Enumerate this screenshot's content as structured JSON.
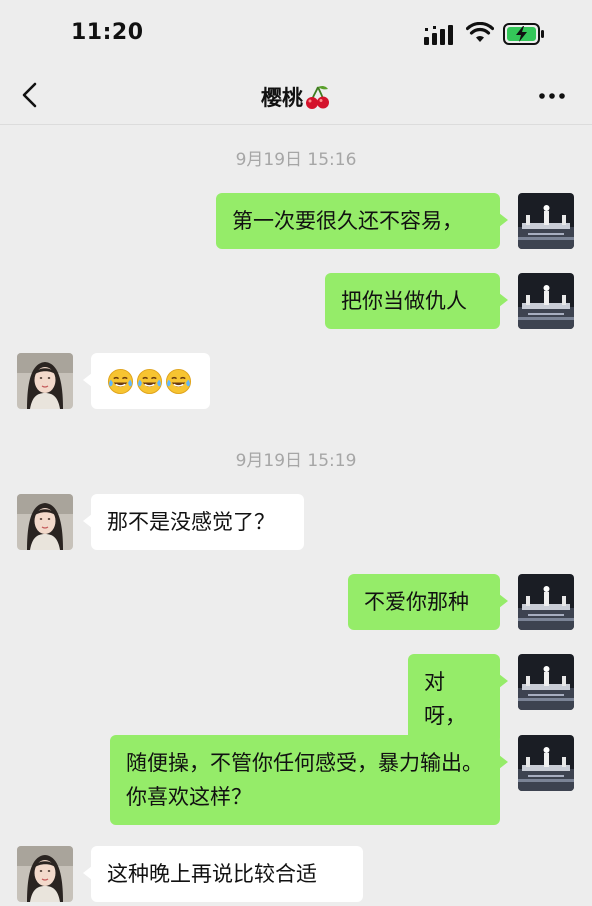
{
  "status_bar": {
    "time": "11:20"
  },
  "header": {
    "title": "樱桃",
    "title_emoji": "cherry-emoji"
  },
  "messages": [
    {
      "type": "timestamp",
      "text": "9月19日 15:16"
    },
    {
      "type": "sent",
      "text": "第一次要很久还不容易，"
    },
    {
      "type": "sent",
      "text": "把你当做仇人"
    },
    {
      "type": "received",
      "emoji": [
        "laughing-crying-emoji",
        "laughing-crying-emoji",
        "laughing-crying-emoji"
      ]
    },
    {
      "type": "timestamp",
      "text": "9月19日 15:19"
    },
    {
      "type": "received",
      "text": "那不是没感觉了？"
    },
    {
      "type": "sent",
      "text": "不爱你那种"
    },
    {
      "type": "sent",
      "text": "对呀，"
    },
    {
      "type": "sent",
      "text": "随便操，不管你任何感受，暴力输出。你喜欢这样？"
    },
    {
      "type": "received",
      "text": "这种晚上再说比较合适"
    }
  ],
  "colors": {
    "sent_bubble": "#95ec69",
    "received_bubble": "#ffffff",
    "background": "#ededed",
    "timestamp_text": "#a6a6a6"
  }
}
